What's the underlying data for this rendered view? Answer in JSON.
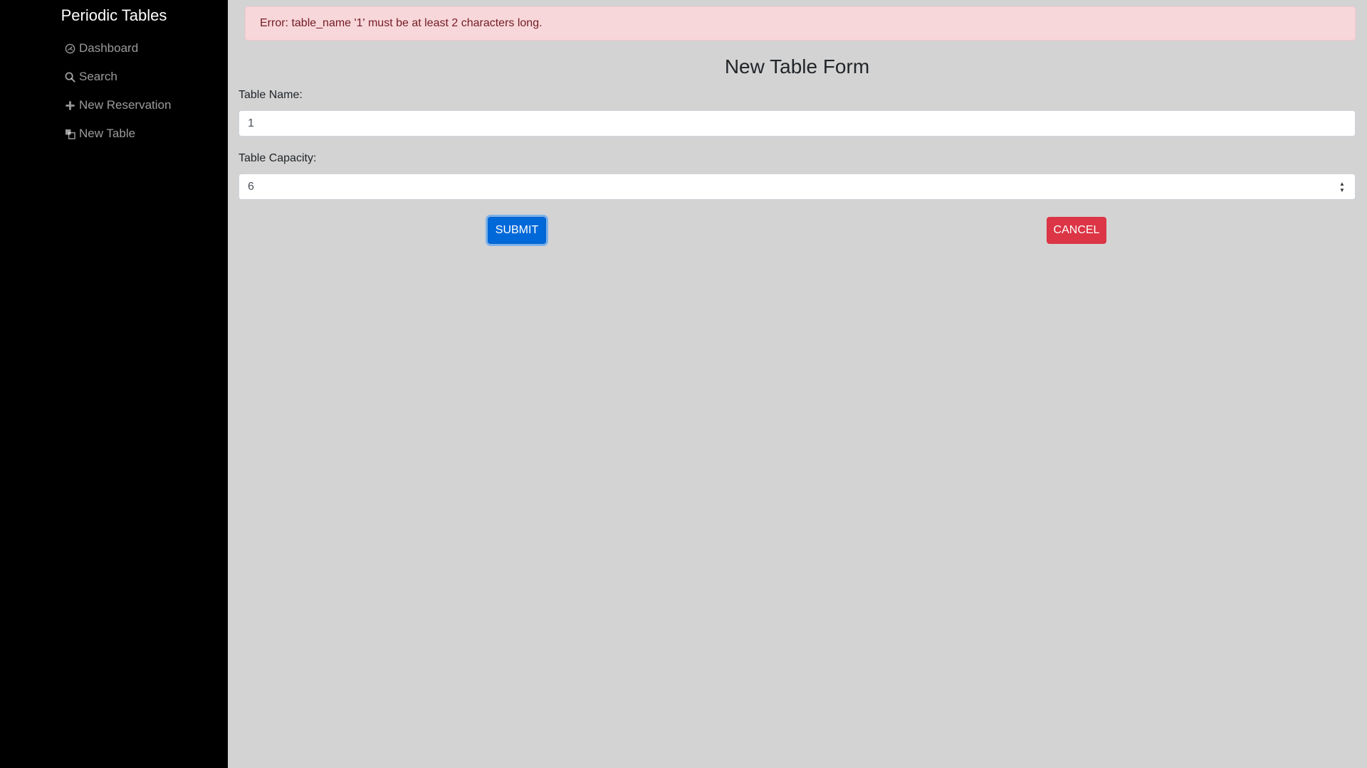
{
  "sidebar": {
    "brand": "Periodic Tables",
    "items": [
      {
        "label": "Dashboard",
        "icon": "dashboard-icon"
      },
      {
        "label": "Search",
        "icon": "search-icon"
      },
      {
        "label": "New Reservation",
        "icon": "plus-icon"
      },
      {
        "label": "New Table",
        "icon": "layers-icon"
      }
    ]
  },
  "alert": {
    "message": "Error: table_name '1' must be at least 2 characters long."
  },
  "form": {
    "title": "New Table Form",
    "table_name": {
      "label": "Table Name:",
      "value": "1"
    },
    "table_capacity": {
      "label": "Table Capacity:",
      "value": "6"
    },
    "submit_label": "SUBMIT",
    "cancel_label": "CANCEL"
  },
  "colors": {
    "sidebar_bg": "#000000",
    "page_bg": "#d3d3d3",
    "alert_bg": "#f8d7da",
    "alert_text": "#721c24",
    "primary": "#0069d9",
    "danger": "#dc3545"
  }
}
